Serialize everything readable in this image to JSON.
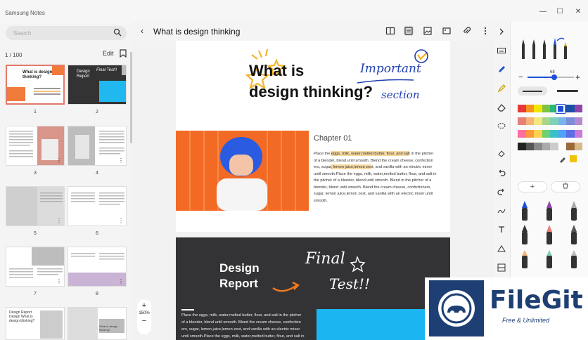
{
  "window": {
    "app_title": "Samsung Notes",
    "minimize": "—",
    "maximize": "☐",
    "close": "✕"
  },
  "sidebar": {
    "search_placeholder": "Search",
    "page_count": "1 / 100",
    "edit_label": "Edit",
    "thumbnails": [
      {
        "num": "1"
      },
      {
        "num": "2"
      },
      {
        "num": "3"
      },
      {
        "num": "4"
      },
      {
        "num": "5"
      },
      {
        "num": "6"
      },
      {
        "num": "7"
      },
      {
        "num": "8"
      }
    ],
    "thumb_texts": {
      "t1": "What is design thinking?",
      "t2a": "Design Report",
      "t2b": "Final Test!!",
      "t9": "Design Report Design What is design thinking?",
      "t10": "What is design thinking?"
    }
  },
  "toolbar": {
    "back": "‹",
    "title": "What is design thinking"
  },
  "page1": {
    "heading_line1": "What is",
    "heading_line2": "design thinking?",
    "handwriting1": "Important",
    "handwriting2": "section",
    "chapter": "Chapter 01",
    "body_lines": [
      "Place the eggs, milk, water,melted butter, flour, and salt in the pitcher",
      "of a blender, blend until smooth. Blend the cream cheese, confection",
      "ers, sugar, lemon juice,lemon zest, and vanilla with an electric mixer",
      "until smooth.Place the eggs, milk, water,melted butter, flour, and salt in",
      "the pitcher of a blender, blend until smooth. Blend in the pitcher of a",
      "blender, blend until smooth. Blend the cream cheese, confrctioners,",
      "sugar, lemon juice,lemon zest, and vanilla with an electric mixer until",
      "smooth."
    ]
  },
  "page2": {
    "title_line1": "Design",
    "title_line2": "Report",
    "handwriting1": "Final",
    "handwriting2": "Test!!",
    "body_lines": [
      "Place the eggs, milk, water,melted butter, flour, and salt in the pitcher",
      "of a blender, blend until smooth. Blend the cream cheese, confection",
      "ers, sugar, lemon juice,lemon zest, and vanilla with an electric mixer",
      "until smooth.Place the eggs, milk, water,melted butter, flour, and salt in"
    ]
  },
  "zoom": {
    "plus": "+",
    "level": "150%",
    "minus": "−"
  },
  "pen_panel": {
    "size_value": "68",
    "minus": "−",
    "plus": "+",
    "add_label": "+",
    "palette_rows": [
      [
        "#e63a3a",
        "#f7941d",
        "#f2e600",
        "#7dc242",
        "#2bb673",
        "#1e88e5",
        "#1a4fa8",
        "#8e44ad"
      ],
      [
        "#e8807a",
        "#f6b37a",
        "#f5e77e",
        "#a8d58a",
        "#7fd1b4",
        "#7ab4ec",
        "#7a8ed9",
        "#b58ad1"
      ],
      [
        "#ff6fa0",
        "#ff9a3d",
        "#ffd24d",
        "#6ed06e",
        "#3ac1c7",
        "#4fa3f7",
        "#5b6ee8",
        "#c77ad8"
      ],
      [
        "#222222",
        "#555555",
        "#888888",
        "#aaaaaa",
        "#cccccc",
        "#ffffff",
        "#9a6b3a",
        "#d8b98a"
      ]
    ],
    "selected_color": "#1e4fd6"
  },
  "watermark": {
    "title": "FileGit",
    "subtitle": "Free & Unlimited"
  }
}
